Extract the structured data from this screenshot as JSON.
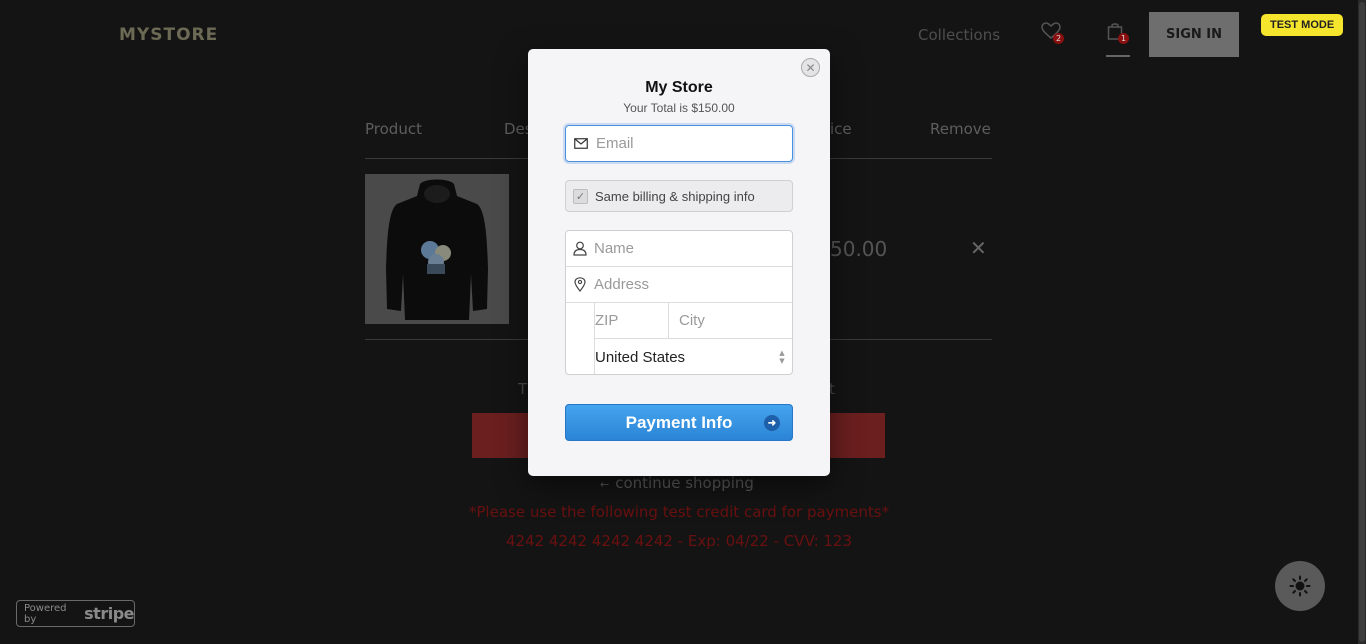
{
  "header": {
    "logo": "MYSTORE",
    "nav_collections": "Collections",
    "wishlist_count": "2",
    "cart_count": "1",
    "sign_in": "SIGN IN",
    "test_mode": "TEST MODE"
  },
  "cart_table": {
    "headers": [
      "Product",
      "Des",
      "ice",
      "Remove"
    ],
    "row": {
      "price_partial": "50.00",
      "remove_label": "✕"
    },
    "total_partial_left": "T",
    "total_partial_right": "t"
  },
  "page": {
    "continue_shopping": "continue shopping",
    "notice_line1": "*Please use the following test credit card for payments*",
    "notice_line2": "4242 4242 4242 4242 - Exp: 04/22 - CVV: 123",
    "stripe_powered": "Powered by",
    "stripe_word": "stripe"
  },
  "checkout_modal": {
    "store_name": "My Store",
    "total_text": "Your Total is $150.00",
    "email_placeholder": "Email",
    "same_billing_label": "Same billing & shipping info",
    "name_placeholder": "Name",
    "address_placeholder": "Address",
    "zip_placeholder": "ZIP",
    "city_placeholder": "City",
    "country_value": "United States",
    "submit_label": "Payment Info"
  },
  "colors": {
    "accent_blue": "#2b84d6",
    "notice_red": "#6a1010",
    "test_mode_yellow": "#f5e62d"
  }
}
